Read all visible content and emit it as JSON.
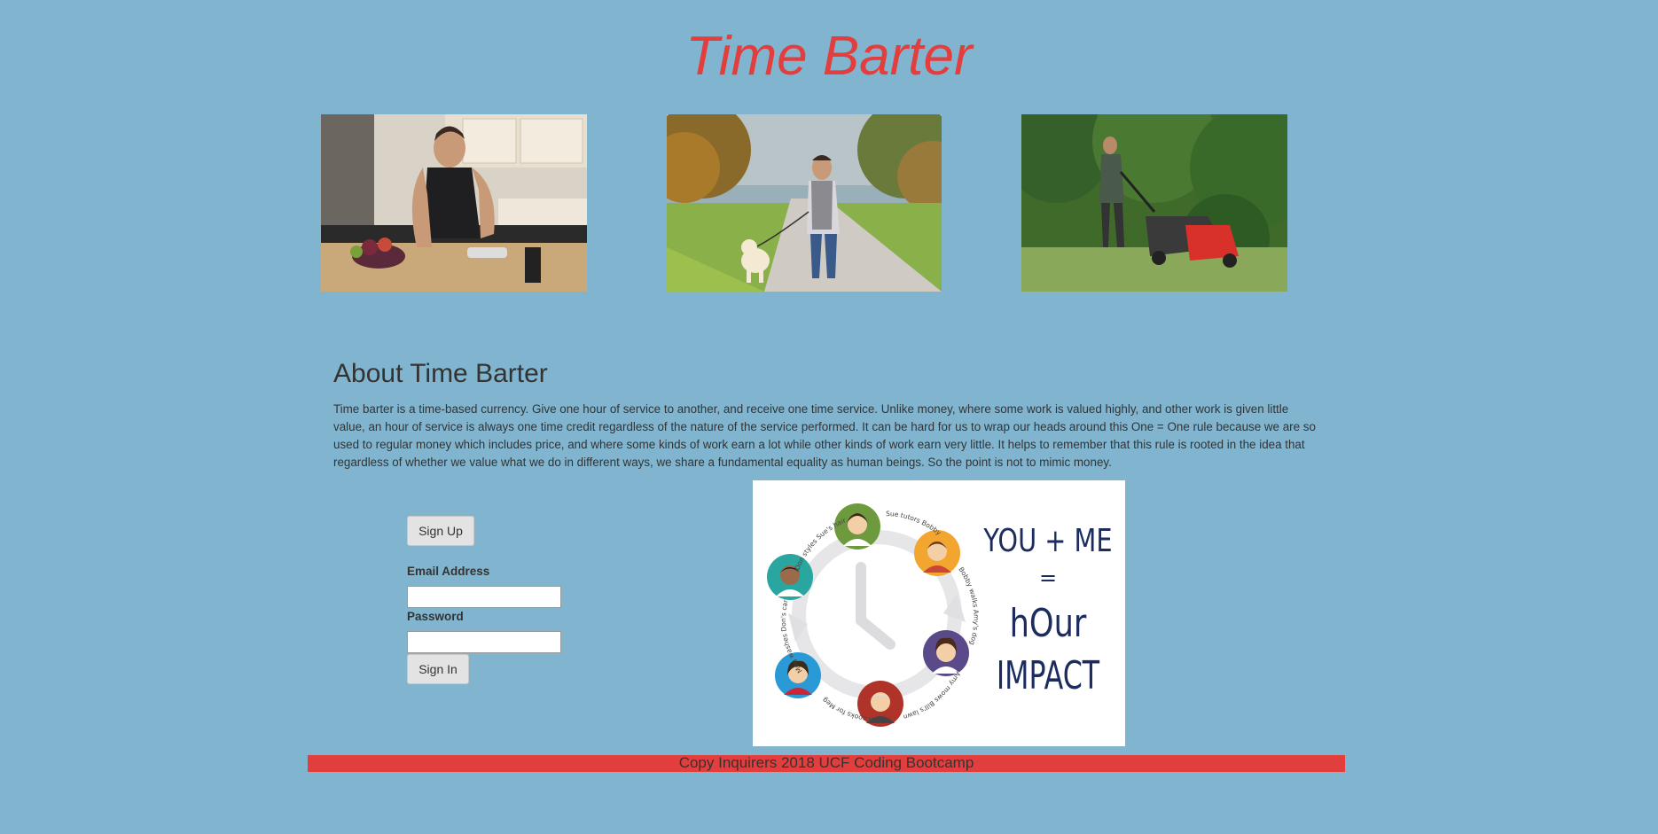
{
  "header": {
    "title": "Time Barter"
  },
  "photos": [
    {
      "icon": "cooking-photo"
    },
    {
      "icon": "dog-walking-photo"
    },
    {
      "icon": "lawn-mowing-photo"
    }
  ],
  "about": {
    "heading": "About Time Barter",
    "body": "Time barter is a time-based currency. Give one hour of service to another, and receive one time service. Unlike money, where some work is valued highly, and other work is given little value, an hour of service is always one time credit regardless of the nature of the service performed. It can be hard for us to wrap our heads around this One = One rule because we are so used to regular money which includes price, and where some kinds of work earn a lot while other kinds of work earn very little. It helps to remember that this rule is rooted in the idea that regardless of whether we value what we do in different ways, we share a fundamental equality as human beings. So the point is not to mimic money."
  },
  "auth": {
    "signup_label": "Sign Up",
    "email_label": "Email Address",
    "password_label": "Password",
    "signin_label": "Sign In"
  },
  "graphic": {
    "line1": "YOU + ME",
    "line2": "=",
    "line3": "hOur",
    "line4": "IMPACT",
    "captions": [
      "Sue tutors Bobby",
      "Bobby walks Amy's dog",
      "Amy mows Bill's lawn",
      "Bill cooks for Meg",
      "Meg washes Don's car",
      "Don styles Sue's hair"
    ]
  },
  "footer": {
    "text": "Copy Inquirers 2018 UCF Coding Bootcamp"
  },
  "colors": {
    "background": "#81b5cf",
    "accent": "#e33e3e",
    "graphic_text": "#1c2c5e"
  }
}
